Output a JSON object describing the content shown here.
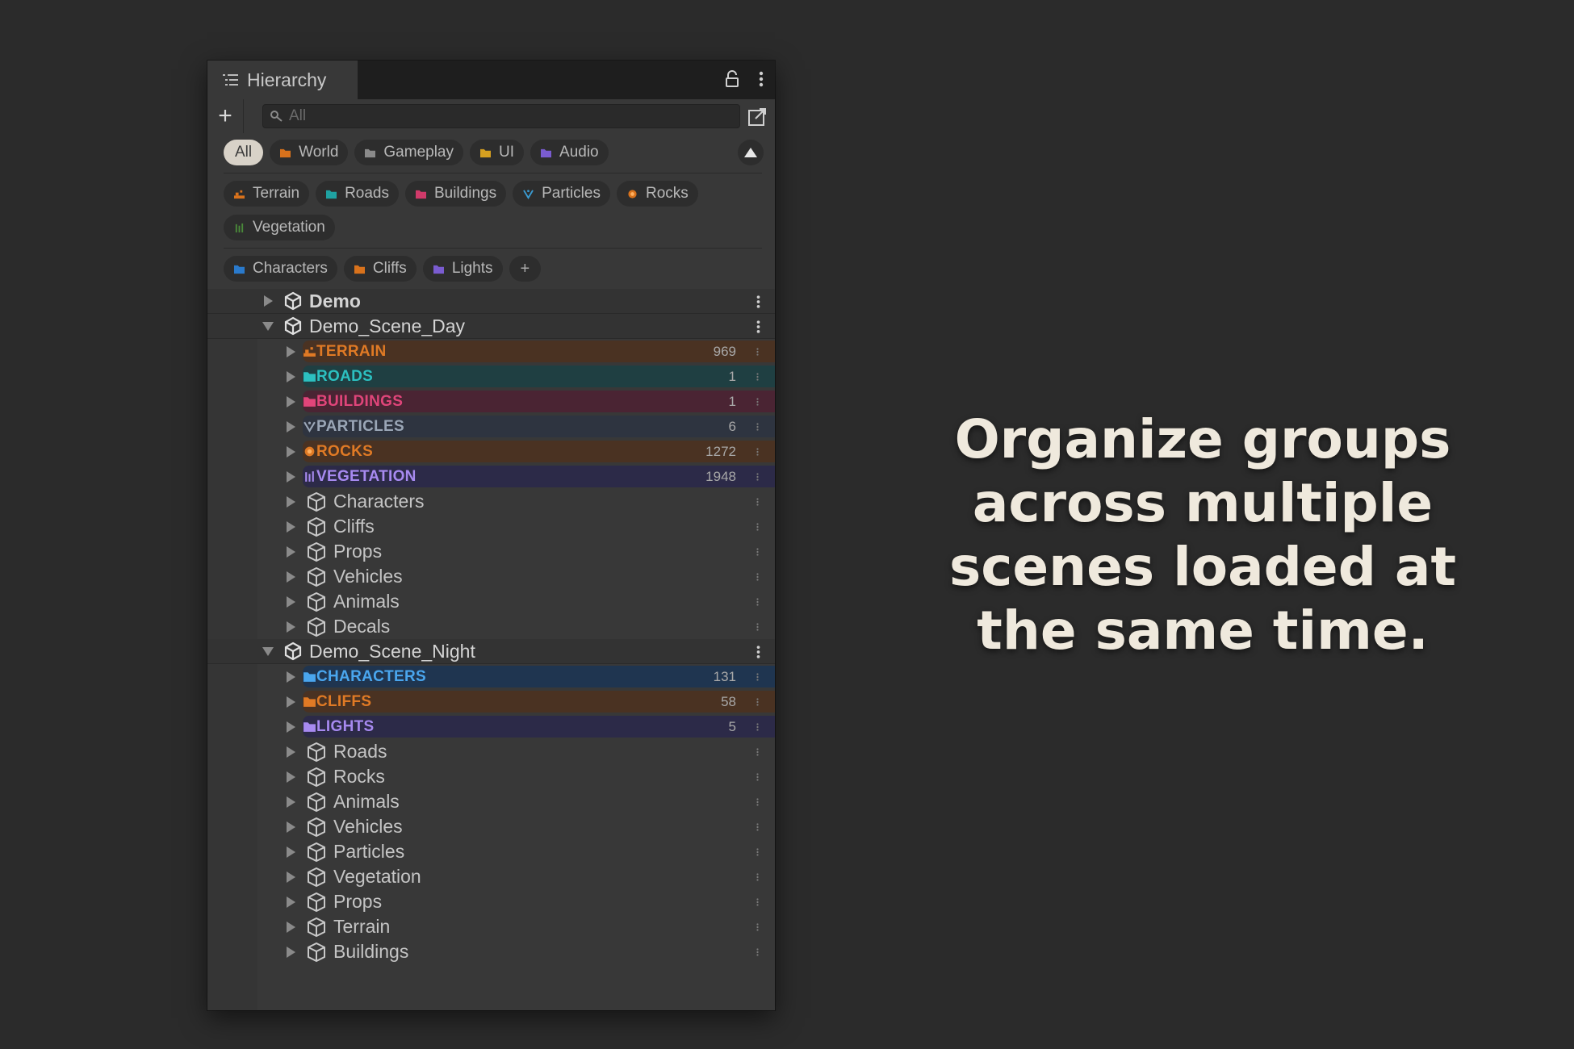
{
  "window": {
    "title": "Hierarchy"
  },
  "toolbar": {
    "add_label": "+",
    "search_placeholder": "All"
  },
  "filter_chips": [
    {
      "label": "All",
      "color": "",
      "active": true
    },
    {
      "label": "World",
      "color": "#d8721c"
    },
    {
      "label": "Gameplay",
      "color": "#8a8a8a"
    },
    {
      "label": "UI",
      "color": "#d6a020"
    },
    {
      "label": "Audio",
      "color": "#7a5cd0"
    }
  ],
  "group_chips": [
    {
      "label": "Terrain",
      "color": "#d8721c",
      "icon": "terrain-icon"
    },
    {
      "label": "Roads",
      "color": "#1fa2a2",
      "icon": "folder-icon"
    },
    {
      "label": "Buildings",
      "color": "#d03a6a",
      "icon": "folder-icon"
    },
    {
      "label": "Particles",
      "color": "#3a9ad0",
      "icon": "particles-icon"
    },
    {
      "label": "Rocks",
      "color": "#d8721c",
      "icon": "rock-icon"
    },
    {
      "label": "Vegetation",
      "color": "#4a8a3a",
      "icon": "vegetation-icon"
    }
  ],
  "scene_chips": [
    {
      "label": "Characters",
      "color": "#2a7acc",
      "icon": "folder-icon"
    },
    {
      "label": "Cliffs",
      "color": "#d8721c",
      "icon": "folder-icon"
    },
    {
      "label": "Lights",
      "color": "#7a5cd0",
      "icon": "folder-icon"
    }
  ],
  "add_chip_label": "+",
  "tree": {
    "scenes": [
      {
        "name": "Demo",
        "expanded": false,
        "bold": true,
        "items": []
      },
      {
        "name": "Demo_Scene_Day",
        "expanded": true,
        "bold": false,
        "items": [
          {
            "type": "group",
            "name": "TERRAIN",
            "count": "969",
            "color": "#e07a25",
            "bg": "#4a3222",
            "icon": "terrain-icon"
          },
          {
            "type": "group",
            "name": "ROADS",
            "count": "1",
            "color": "#2cc0c0",
            "bg": "#1f3f42",
            "icon": "folder-icon"
          },
          {
            "type": "group",
            "name": "BUILDINGS",
            "count": "1",
            "color": "#e0457a",
            "bg": "#4a2433",
            "icon": "folder-icon"
          },
          {
            "type": "group",
            "name": "PARTICLES",
            "count": "6",
            "color": "#9aa6b6",
            "bg": "#2e3440",
            "icon": "particles-icon"
          },
          {
            "type": "group",
            "name": "ROCKS",
            "count": "1272",
            "color": "#e07a25",
            "bg": "#4a3222",
            "icon": "rock-icon"
          },
          {
            "type": "group",
            "name": "VEGETATION",
            "count": "1948",
            "color": "#a78af0",
            "bg": "#2c2a48",
            "icon": "vegetation-icon"
          },
          {
            "type": "object",
            "name": "Characters"
          },
          {
            "type": "object",
            "name": "Cliffs"
          },
          {
            "type": "object",
            "name": "Props"
          },
          {
            "type": "object",
            "name": "Vehicles"
          },
          {
            "type": "object",
            "name": "Animals"
          },
          {
            "type": "object",
            "name": "Decals"
          }
        ]
      },
      {
        "name": "Demo_Scene_Night",
        "expanded": true,
        "bold": false,
        "items": [
          {
            "type": "group",
            "name": "CHARACTERS",
            "count": "131",
            "color": "#4aa6ee",
            "bg": "#1f3550",
            "icon": "folder-icon"
          },
          {
            "type": "group",
            "name": "CLIFFS",
            "count": "58",
            "color": "#e07a25",
            "bg": "#4a3222",
            "icon": "folder-icon"
          },
          {
            "type": "group",
            "name": "LIGHTS",
            "count": "5",
            "color": "#a78af0",
            "bg": "#2c2a48",
            "icon": "folder-icon"
          },
          {
            "type": "object",
            "name": "Roads"
          },
          {
            "type": "object",
            "name": "Rocks"
          },
          {
            "type": "object",
            "name": "Animals"
          },
          {
            "type": "object",
            "name": "Vehicles"
          },
          {
            "type": "object",
            "name": "Particles"
          },
          {
            "type": "object",
            "name": "Vegetation"
          },
          {
            "type": "object",
            "name": "Props"
          },
          {
            "type": "object",
            "name": "Terrain"
          },
          {
            "type": "object",
            "name": "Buildings"
          }
        ]
      }
    ]
  },
  "caption": "Organize groups across multiple scenes loaded at the same time."
}
